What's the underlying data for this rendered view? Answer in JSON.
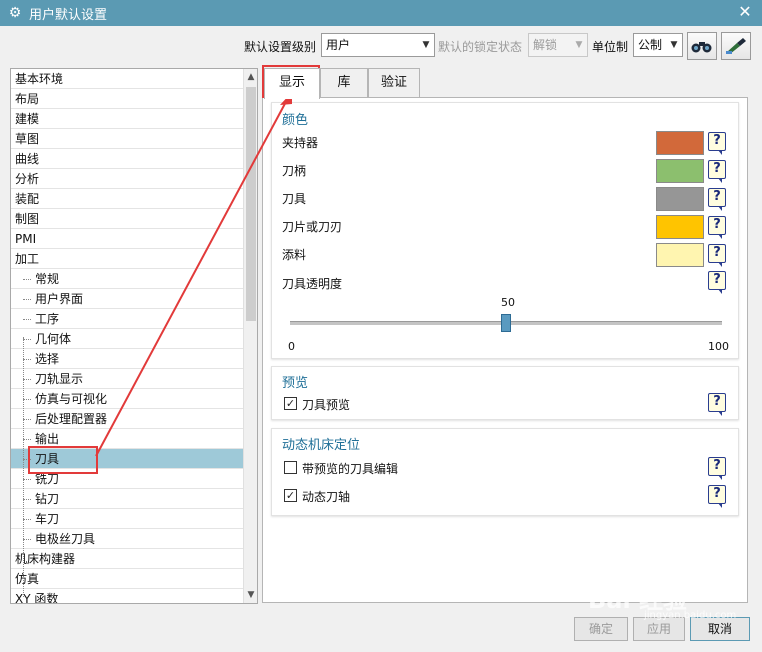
{
  "window": {
    "title": "用户默认设置",
    "close_symbol": "✕"
  },
  "toolbar": {
    "level_label": "默认设置级别",
    "level_value": "用户",
    "lock_label": "默认的锁定状态",
    "lock_value": "解锁",
    "unit_label": "单位制",
    "unit_value": "公制",
    "icons": [
      "binoculars-icon",
      "customize-icon"
    ]
  },
  "tree": {
    "items": [
      {
        "label": "基本环境"
      },
      {
        "label": "布局"
      },
      {
        "label": "建模"
      },
      {
        "label": "草图"
      },
      {
        "label": "曲线"
      },
      {
        "label": "分析"
      },
      {
        "label": "装配"
      },
      {
        "label": "制图"
      },
      {
        "label": "PMI"
      },
      {
        "label": "加工"
      },
      {
        "label": "常规"
      },
      {
        "label": "用户界面"
      },
      {
        "label": "工序"
      },
      {
        "label": "几何体"
      },
      {
        "label": "选择"
      },
      {
        "label": "刀轨显示"
      },
      {
        "label": "仿真与可视化"
      },
      {
        "label": "后处理配置器"
      },
      {
        "label": "输出"
      },
      {
        "label": "刀具"
      },
      {
        "label": "铣刀"
      },
      {
        "label": "钻刀"
      },
      {
        "label": "车刀"
      },
      {
        "label": "电极丝刀具"
      },
      {
        "label": "机床构建器"
      },
      {
        "label": "仿真"
      },
      {
        "label": "XY 函数"
      }
    ],
    "selected_label": "刀具"
  },
  "tabs": [
    {
      "label": "显示"
    },
    {
      "label": "库"
    },
    {
      "label": "验证"
    }
  ],
  "color_group": {
    "title": "颜色",
    "rows": [
      {
        "label": "夹持器",
        "color": "#d2693a"
      },
      {
        "label": "刀柄",
        "color": "#8cbf6e"
      },
      {
        "label": "刀具",
        "color": "#969696"
      },
      {
        "label": "刀片或刀刃",
        "color": "#ffc400"
      },
      {
        "label": "添料",
        "color": "#fff5b0"
      }
    ],
    "transparency_label": "刀具透明度",
    "slider_value": "50",
    "slider_min": "0",
    "slider_max": "100",
    "slider_fraction": 0.5
  },
  "preview_group": {
    "title": "预览",
    "checkbox_label": "刀具预览",
    "checked": true
  },
  "machine_group": {
    "title": "动态机床定位",
    "items": [
      {
        "label": "带预览的刀具编辑",
        "checked": false
      },
      {
        "label": "动态刀轴",
        "checked": true
      }
    ]
  },
  "help_symbol": "?",
  "buttons": {
    "ok": "确定",
    "apply": "应用",
    "cancel": "取消"
  },
  "watermark": {
    "text": "Bai 经验",
    "sub": "jingyan.baidu.com"
  },
  "annotation_color": "#e23a3a"
}
